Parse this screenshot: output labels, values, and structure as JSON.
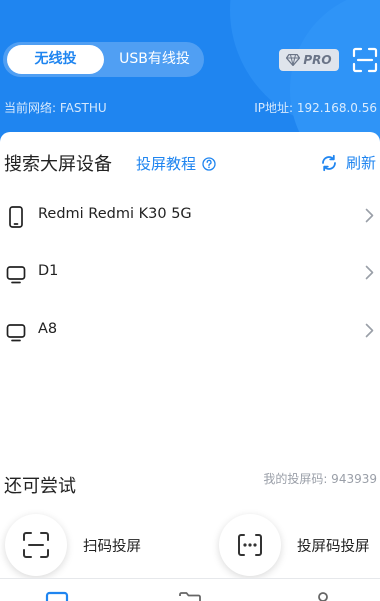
{
  "colors": {
    "accent": "#1f85f0",
    "header_bg": "#1f85f0",
    "card_bg": "#ffffff"
  },
  "header": {
    "mode_tabs": [
      {
        "label": "无线投",
        "active": true
      },
      {
        "label": "USB有线投",
        "active": false
      }
    ],
    "pro_badge": "PRO",
    "pro_icon": "diamond-icon",
    "scan_icon": "scan-icon",
    "network_label": "当前网络: FASTHU",
    "ip_label": "IP地址: 192.168.0.56"
  },
  "search": {
    "title": "搜索大屏设备",
    "tutorial_label": "投屏教程",
    "refresh_label": "刷新"
  },
  "devices": [
    {
      "name": "Redmi Redmi K30 5G",
      "icon": "phone-icon"
    },
    {
      "name": "D1",
      "icon": "tv-icon"
    },
    {
      "name": "A8",
      "icon": "tv-icon"
    }
  ],
  "more": {
    "title": "还可尝试",
    "my_code": "我的投屏码: 943939",
    "actions": [
      {
        "label": "扫码投屏",
        "icon": "scan-qr-icon"
      },
      {
        "label": "投屏码投屏",
        "icon": "code-cast-icon"
      }
    ]
  },
  "tabbar": {
    "tabs": [
      {
        "icon": "screen-icon",
        "active": true
      },
      {
        "icon": "folder-icon",
        "active": false
      },
      {
        "icon": "profile-icon",
        "active": false
      }
    ]
  }
}
